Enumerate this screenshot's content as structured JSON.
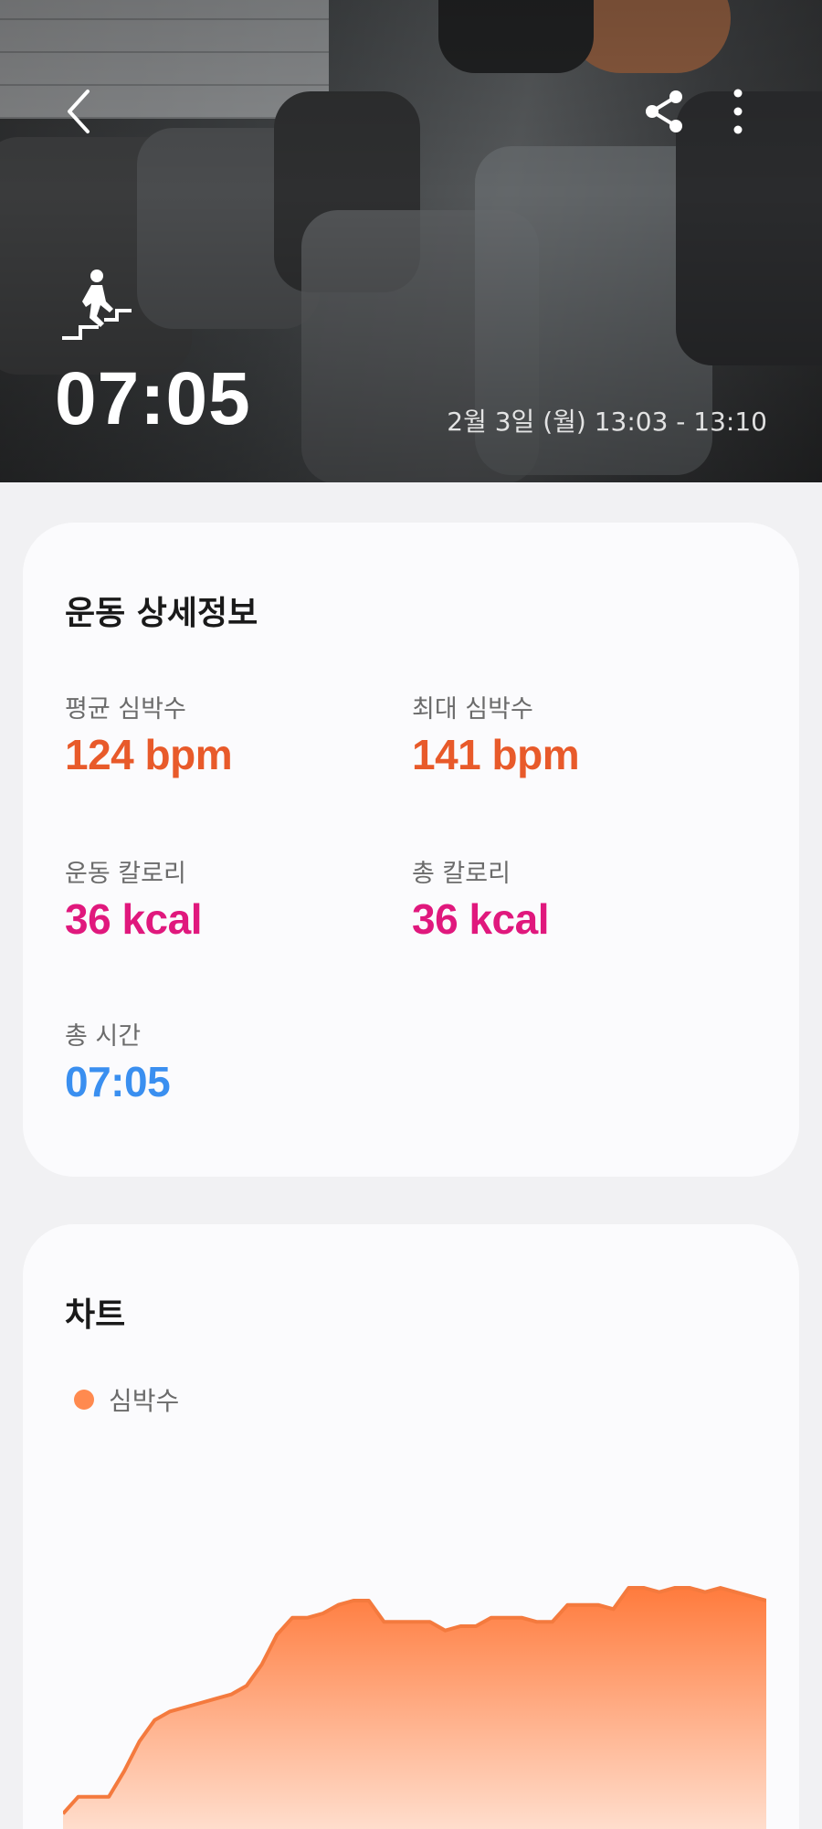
{
  "hero": {
    "duration": "07:05",
    "date_range": "2월 3일 (월) 13:03 - 13:10",
    "workout_icon": "stair-climbing-icon"
  },
  "header": {
    "back_icon": "chevron-left-icon",
    "share_icon": "share-icon",
    "more_icon": "more-vertical-icon"
  },
  "details": {
    "title": "운동 상세정보",
    "avg_hr_label": "평균 심박수",
    "avg_hr_value": "124 bpm",
    "max_hr_label": "최대 심박수",
    "max_hr_value": "141 bpm",
    "workout_cal_label": "운동 칼로리",
    "workout_cal_value": "36 kcal",
    "total_cal_label": "총 칼로리",
    "total_cal_value": "36 kcal",
    "total_time_label": "총 시간",
    "total_time_value": "07:05"
  },
  "chart": {
    "title": "차트",
    "legend_label": "심박수",
    "colors": {
      "fill_top": "#ff7b3d",
      "fill_bottom": "#fff3ec",
      "line": "#f47a3e"
    }
  },
  "chart_data": {
    "type": "area",
    "series": [
      {
        "name": "심박수",
        "values": [
          86,
          90,
          90,
          90,
          96,
          103,
          108,
          110,
          111,
          112,
          113,
          114,
          116,
          121,
          128,
          132,
          132,
          133,
          135,
          136,
          136,
          131,
          131,
          131,
          131,
          129,
          130,
          130,
          132,
          132,
          132,
          131,
          131,
          135,
          135,
          135,
          134,
          139,
          139,
          138,
          139,
          139,
          138,
          139,
          138,
          137,
          136
        ]
      }
    ]
  }
}
